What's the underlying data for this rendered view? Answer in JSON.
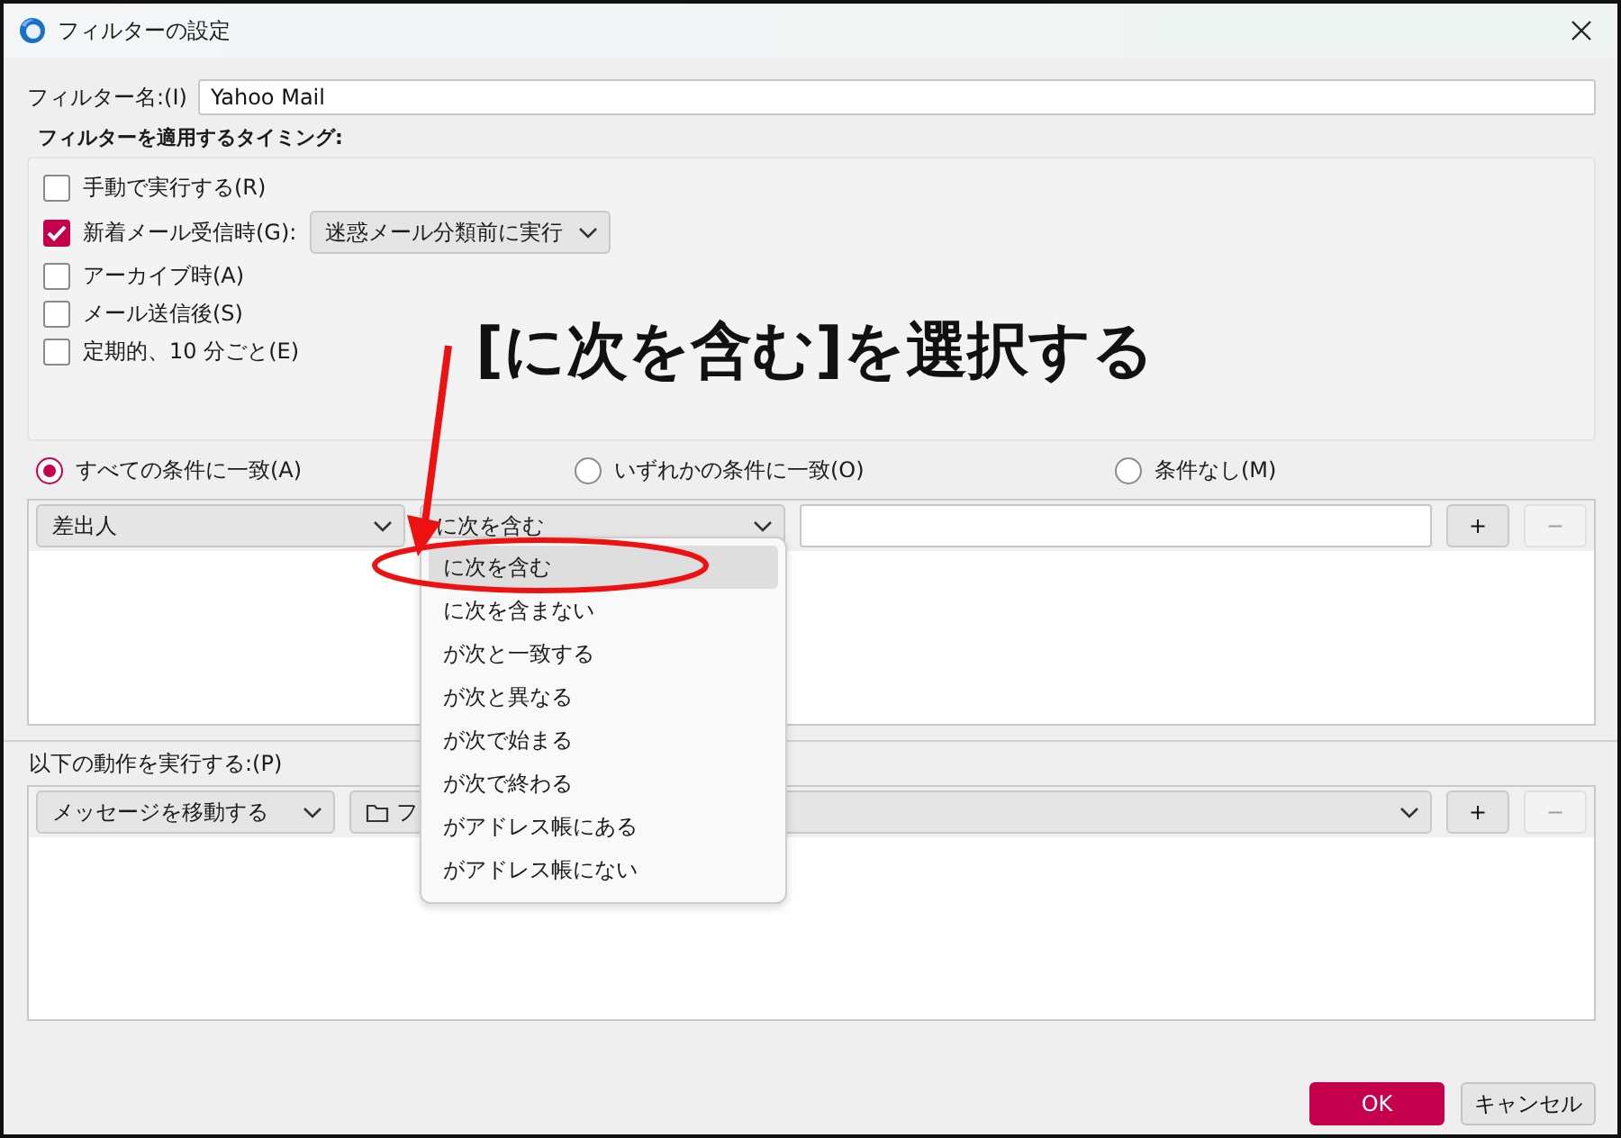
{
  "window": {
    "title": "フィルターの設定"
  },
  "filter_name": {
    "label": "フィルター名:(I)",
    "value": "Yahoo Mail"
  },
  "timing": {
    "label": "フィルターを適用するタイミング:",
    "options": [
      {
        "label": "手動で実行する(R)",
        "checked": false
      },
      {
        "label": "新着メール受信時(G):",
        "checked": true,
        "select": "迷惑メール分類前に実行"
      },
      {
        "label": "アーカイブ時(A)",
        "checked": false
      },
      {
        "label": "メール送信後(S)",
        "checked": false
      },
      {
        "label": "定期的、10 分ごと(E)",
        "checked": false
      }
    ]
  },
  "match": [
    {
      "label": "すべての条件に一致(A)",
      "selected": true
    },
    {
      "label": "いずれかの条件に一致(O)",
      "selected": false
    },
    {
      "label": "条件なし(M)",
      "selected": false
    }
  ],
  "condition": {
    "field": "差出人",
    "operator": "に次を含む",
    "buttons": [
      {
        "label": "+",
        "disabled": false
      },
      {
        "label": "−",
        "disabled": true
      }
    ]
  },
  "operator_menu": [
    {
      "label": "に次を含む",
      "selected": true
    },
    {
      "label": "に次を含まない",
      "selected": false
    },
    {
      "label": "が次と一致する",
      "selected": false
    },
    {
      "label": "が次と異なる",
      "selected": false
    },
    {
      "label": "が次で始まる",
      "selected": false
    },
    {
      "label": "が次で終わる",
      "selected": false
    },
    {
      "label": "がアドレス帳にある",
      "selected": false
    },
    {
      "label": "がアドレス帳にない",
      "selected": false
    }
  ],
  "actions": {
    "label": "以下の動作を実行する:(P)",
    "action": "メッセージを移動する",
    "target": "フ",
    "buttons": [
      {
        "label": "+",
        "disabled": false
      },
      {
        "label": "−",
        "disabled": true
      }
    ]
  },
  "buttons": [
    {
      "label": "OK",
      "kind": "primary"
    },
    {
      "label": "キャンセル",
      "kind": "default"
    }
  ],
  "annotation": {
    "text": "[に次を含む]を選択する"
  }
}
